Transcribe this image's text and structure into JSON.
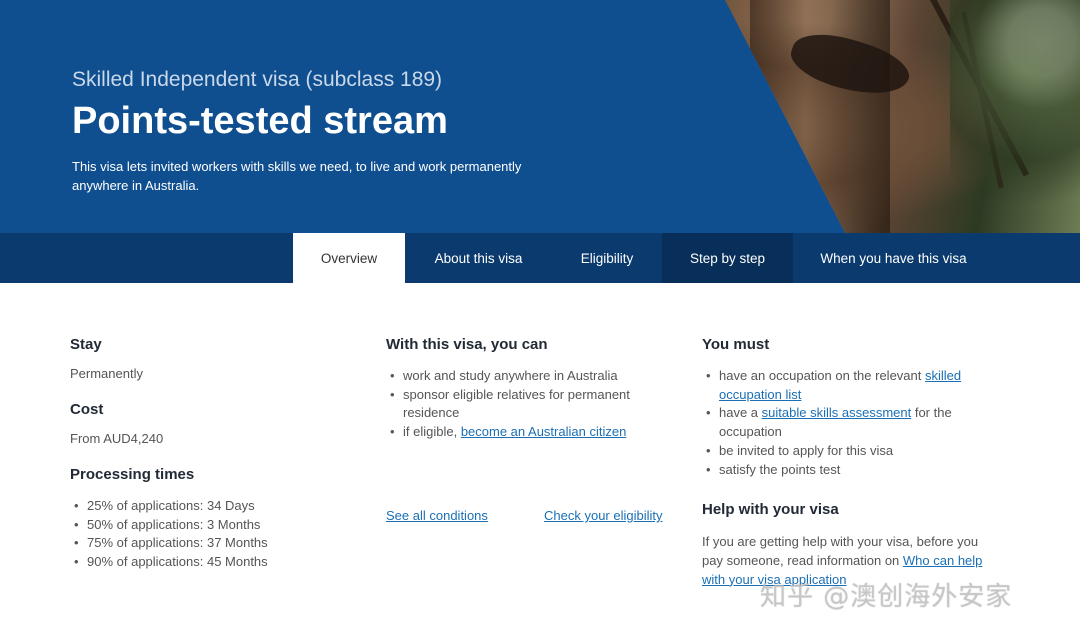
{
  "hero": {
    "subtitle": "Skilled Independent visa (subclass 189)",
    "title": "Points-tested stream",
    "description": "This visa lets invited workers with skills we need, to live and work permanently anywhere in Australia."
  },
  "tabs": [
    {
      "label": "Overview",
      "active": true
    },
    {
      "label": "About this visa",
      "active": false
    },
    {
      "label": "Eligibility",
      "active": false
    },
    {
      "label": "Step by step",
      "active": false
    },
    {
      "label": "When you have this visa",
      "active": false
    }
  ],
  "stay": {
    "heading": "Stay",
    "value": "Permanently"
  },
  "cost": {
    "heading": "Cost",
    "value": "From AUD4,240"
  },
  "processing": {
    "heading": "Processing times",
    "items": [
      "25% of applications: 34 Days",
      "50% of applications: 3 Months",
      "75% of applications: 37 Months",
      "90% of applications: 45 Months"
    ]
  },
  "can": {
    "heading": "With this visa, you can",
    "item1": "work and study anywhere in Australia",
    "item2": "sponsor eligible relatives for permanent residence",
    "item3_prefix": "if eligible, ",
    "item3_link": "become an Australian citizen",
    "see_all": "See all conditions",
    "check": "Check your eligibility"
  },
  "must": {
    "heading": "You must",
    "item1_prefix": "have an occupation on the relevant ",
    "item1_link": "skilled occupation list",
    "item2_prefix": "have a ",
    "item2_link": "suitable skills assessment",
    "item2_suffix": " for the occupation",
    "item3": "be invited to apply for this visa",
    "item4": "satisfy the points test"
  },
  "help": {
    "heading": "Help with your visa",
    "text_prefix": "If you are getting help with your visa, before you pay someone, read information on ",
    "link": "Who can help with your visa application"
  },
  "watermark": "知乎 @澳创海外安家",
  "colors": {
    "hero_blue": "#0f4f8f",
    "tab_bar": "#0b3b6e",
    "link": "#1b6fb5"
  }
}
